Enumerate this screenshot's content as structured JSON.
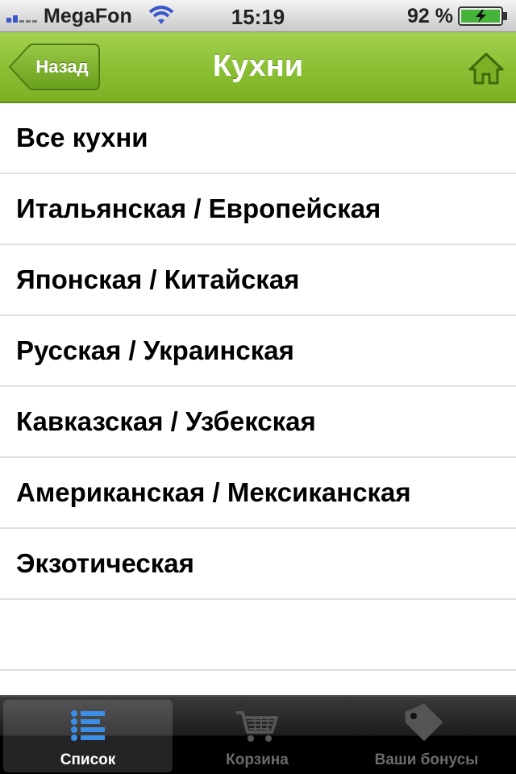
{
  "status_bar": {
    "carrier": "MegaFon",
    "time": "15:19",
    "battery_percent": "92 %"
  },
  "nav": {
    "back_label": "Назад",
    "title": "Кухни",
    "home_icon": "home-icon"
  },
  "list": {
    "items": [
      {
        "label": "Все кухни"
      },
      {
        "label": "Итальянская / Европейская"
      },
      {
        "label": "Японская / Китайская"
      },
      {
        "label": "Русская / Украинская"
      },
      {
        "label": "Кавказская / Узбекская"
      },
      {
        "label": "Американская / Мексиканская"
      },
      {
        "label": "Экзотическая"
      }
    ]
  },
  "tab_bar": {
    "tabs": [
      {
        "label": "Список",
        "icon": "list-icon",
        "active": true
      },
      {
        "label": "Корзина",
        "icon": "cart-icon",
        "active": false
      },
      {
        "label": "Ваши бонусы",
        "icon": "tag-icon",
        "active": false
      }
    ]
  },
  "colors": {
    "nav_green": "#8bc034",
    "active_tab_icon": "#3a8ee6"
  }
}
